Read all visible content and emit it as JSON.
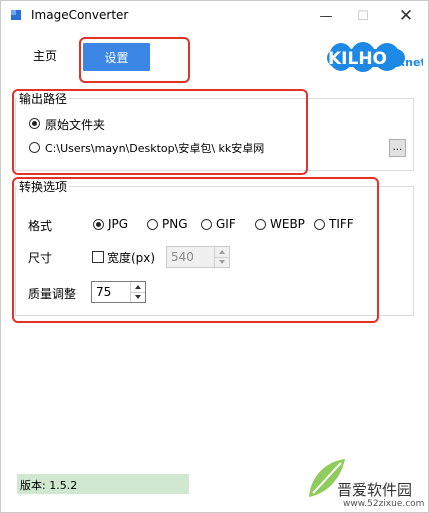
{
  "window": {
    "title": "ImageConverter",
    "controls": {
      "minimize": "—",
      "maximize": "☐",
      "close": "✕"
    }
  },
  "tabs": {
    "main": "主页",
    "settings": "设置"
  },
  "logo": {
    "text": "KILHO",
    "suffix": ".net"
  },
  "output_path": {
    "title": "输出路径",
    "options": [
      {
        "label": "原始文件夹",
        "checked": true
      },
      {
        "label": "C:\\Users\\mayn\\Desktop\\安卓包\\ kk安卓网",
        "checked": false
      }
    ],
    "browse_label": "..."
  },
  "convert_options": {
    "title": "转换选项",
    "format_label": "格式",
    "formats": [
      {
        "label": "JPG",
        "checked": true
      },
      {
        "label": "PNG",
        "checked": false
      },
      {
        "label": "GIF",
        "checked": false
      },
      {
        "label": "WEBP",
        "checked": false
      },
      {
        "label": "TIFF",
        "checked": false
      }
    ],
    "size_label": "尺寸",
    "width_checkbox_label": "宽度(px)",
    "width_checked": false,
    "width_value": "540",
    "quality_label": "质量调整",
    "quality_value": "75"
  },
  "version": "版本: 1.5.2",
  "watermark": {
    "text": "晋爱软件园",
    "url": "www.52zixue.com"
  },
  "colors": {
    "accent": "#3b86e4",
    "highlight_frame": "#e0342a",
    "version_bg": "#cfe8cf"
  }
}
